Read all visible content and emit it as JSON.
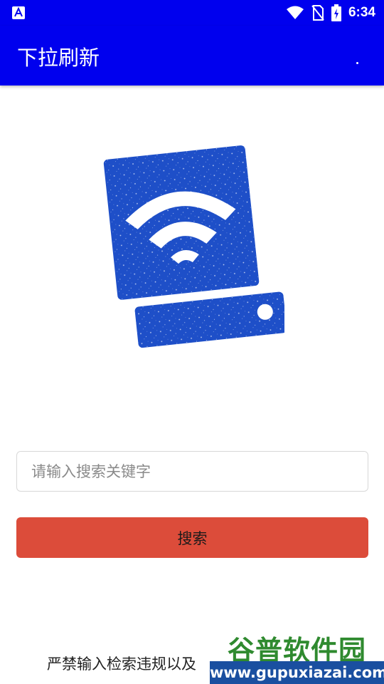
{
  "status_bar": {
    "time": "6:34",
    "left_icon": "accessibility-a-icon",
    "icons": [
      "wifi-icon",
      "no-sim-icon",
      "battery-charging-icon"
    ]
  },
  "toolbar": {
    "title": "下拉刷新",
    "overflow_icon": "overflow-menu-icon"
  },
  "logo": {
    "icon": "wifi-storage-logo-icon"
  },
  "search": {
    "placeholder": "请输入搜索关键字",
    "value": ""
  },
  "search_button": {
    "label": "搜索"
  },
  "notice": {
    "text": "严禁输入检索违规以及"
  },
  "watermark": {
    "title": "谷普软件园",
    "url": "www.gupuxiazai.com"
  },
  "colors": {
    "primary": "#0000ee",
    "button": "#dc4c3a",
    "logo_blue": "#1e4fc8",
    "watermark_green": "#2f8a2f",
    "watermark_blue": "#1a4fa0"
  }
}
